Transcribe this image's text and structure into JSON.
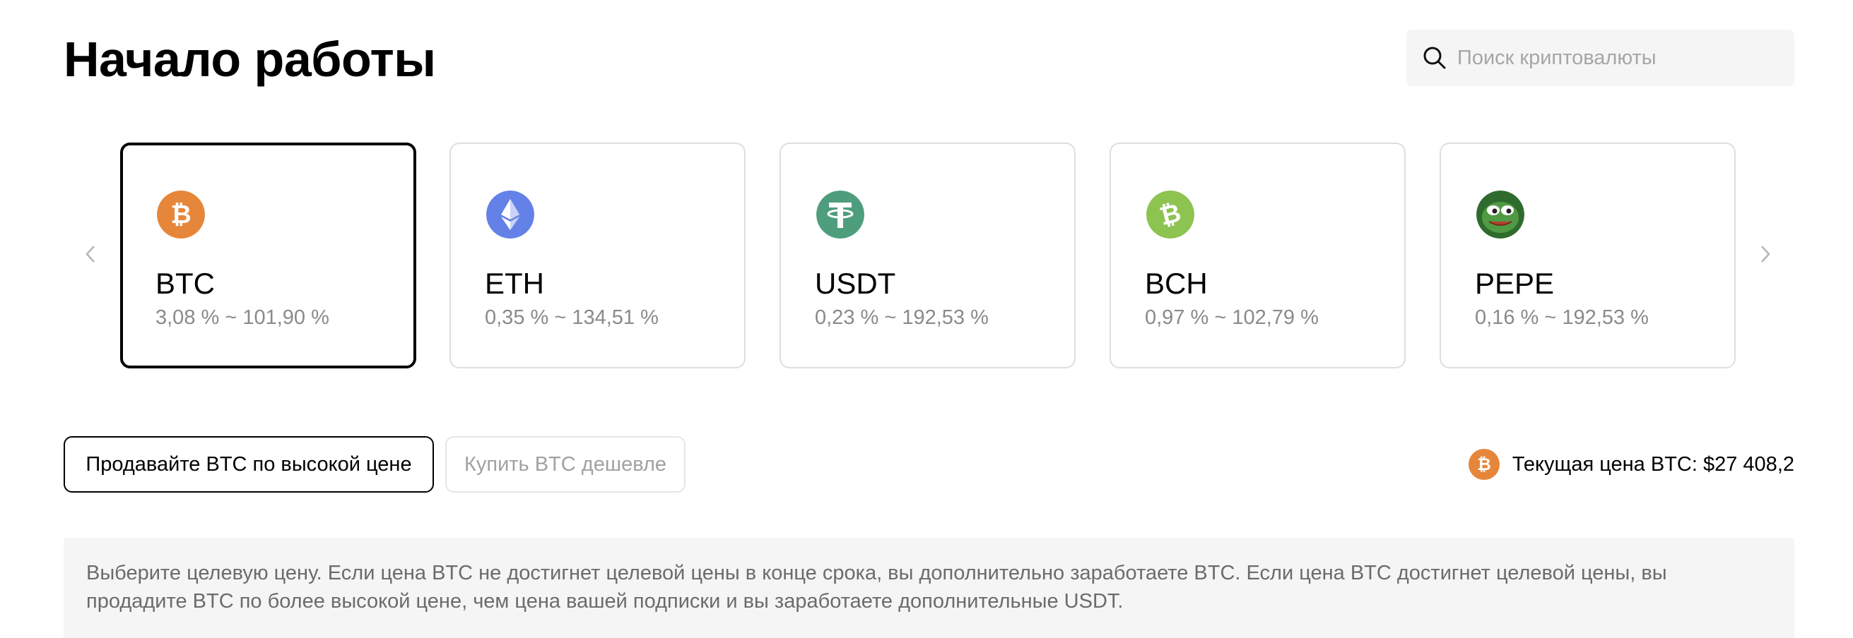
{
  "header": {
    "title": "Начало работы"
  },
  "search": {
    "placeholder": "Поиск криптовалюты",
    "icon": "search-icon"
  },
  "carousel": {
    "prev_icon": "chevron-left-icon",
    "next_icon": "chevron-right-icon",
    "selected": "BTC",
    "cards": [
      {
        "symbol": "BTC",
        "range": "3,08 % ~ 101,90 %",
        "icon": "bitcoin-icon",
        "color": "#e6863a"
      },
      {
        "symbol": "ETH",
        "range": "0,35 % ~ 134,51 %",
        "icon": "ethereum-icon",
        "color": "#6481e8"
      },
      {
        "symbol": "USDT",
        "range": "0,23 % ~ 192,53 %",
        "icon": "tether-icon",
        "color": "#4e9e7d"
      },
      {
        "symbol": "BCH",
        "range": "0,97 % ~ 102,79 %",
        "icon": "bitcoin-cash-icon",
        "color": "#8dc351"
      },
      {
        "symbol": "PEPE",
        "range": "0,16 % ~ 192,53 %",
        "icon": "pepe-frog-icon",
        "color": "#3f8a3c"
      }
    ]
  },
  "actions": {
    "sell_label": "Продавайте BTC по высокой цене",
    "buy_label": "Купить BTC дешевле"
  },
  "price": {
    "label": "Текущая цена BTC: $27 408,2",
    "icon": "bitcoin-icon"
  },
  "info": {
    "text": "Выберите целевую цену. Если цена BTC не достигнет целевой цены в конце срока, вы дополнительно заработаете BTC. Если цена BTC достигнет целевой цены, вы продадите BTC по более высокой цене, чем цена вашей подписки и вы заработаете дополнительные USDT."
  },
  "colors": {
    "selected_border": "#000000",
    "card_border": "#dedede",
    "muted_text": "#8a8a8a",
    "panel_bg": "#f5f5f5"
  }
}
